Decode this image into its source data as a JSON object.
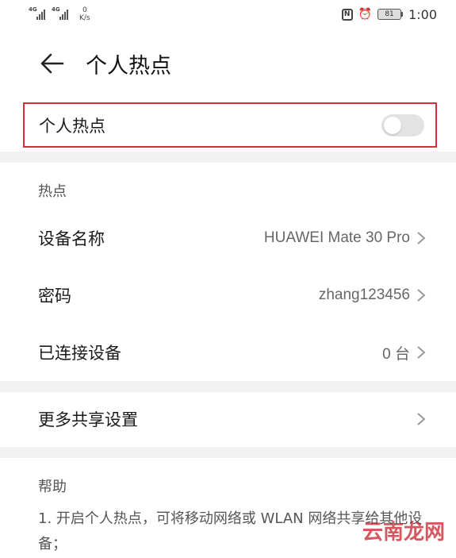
{
  "status_bar": {
    "signal1_label": "4G",
    "signal2_label": "4G",
    "net_speed_value": "0",
    "net_speed_unit": "K/s",
    "nfc_label": "N",
    "battery_level": "81",
    "time": "1:00"
  },
  "header": {
    "title": "个人热点"
  },
  "main_toggle": {
    "label": "个人热点",
    "enabled": false
  },
  "hotspot_section": {
    "label": "热点",
    "items": [
      {
        "label": "设备名称",
        "value": "HUAWEI Mate 30 Pro"
      },
      {
        "label": "密码",
        "value": "zhang123456"
      },
      {
        "label": "已连接设备",
        "value": "0 台"
      }
    ]
  },
  "more_sharing": {
    "label": "更多共享设置"
  },
  "help": {
    "label": "帮助",
    "text": "1. 开启个人热点，可将移动网络或 WLAN 网络共享给其他设备；"
  },
  "watermark": "云南龙网",
  "colors": {
    "highlight_border": "#d32f3a",
    "separator": "#f1f1f1",
    "switch_off": "#e3e3e3"
  }
}
